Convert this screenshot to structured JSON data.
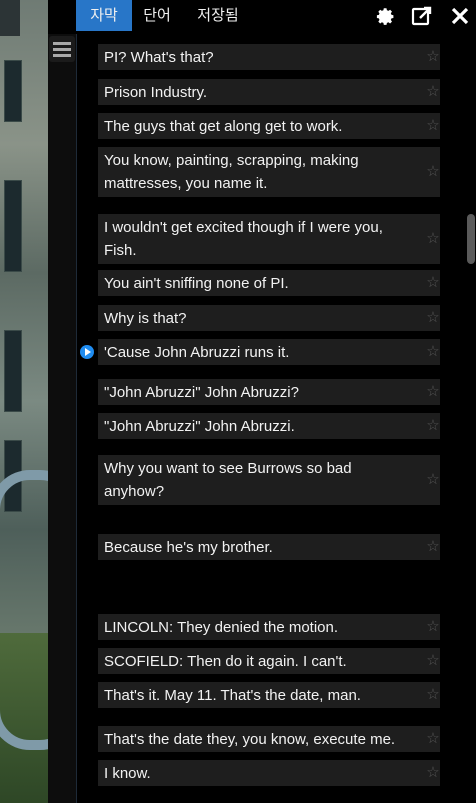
{
  "tabs": [
    {
      "label": "자막",
      "active": true
    },
    {
      "label": "단어",
      "active": false
    },
    {
      "label": "저장됨",
      "active": false
    }
  ],
  "toolbar_icons": [
    "gear-icon",
    "share-icon",
    "close-icon"
  ],
  "accent_color": "#2876c8",
  "subtitles": [
    {
      "text": "PI? What's that?"
    },
    {
      "text": "Prison Industry."
    },
    {
      "text": "The guys that get along get to work."
    },
    {
      "text": "You know, painting, scrapping, making mattresses, you name it."
    },
    {
      "text": "I wouldn't get excited though if I were you, Fish."
    },
    {
      "text": "You ain't sniffing none of PI."
    },
    {
      "text": "Why is that?"
    },
    {
      "text": "'Cause John Abruzzi runs it.",
      "current": true
    },
    {
      "text": "\"John Abruzzi\" John Abruzzi?"
    },
    {
      "text": "\"John Abruzzi\" John Abruzzi."
    },
    {
      "text": "Why you want to see Burrows so bad anyhow?"
    },
    {
      "text": "Because he's my brother."
    },
    {
      "text": "LINCOLN: They denied the motion."
    },
    {
      "text": "SCOFIELD: Then do it again. I can't."
    },
    {
      "text": "That's it. May 11. That's the date, man."
    },
    {
      "text": "That's the date they, you know, execute me."
    },
    {
      "text": "I know."
    }
  ],
  "star_glyph": "☆"
}
